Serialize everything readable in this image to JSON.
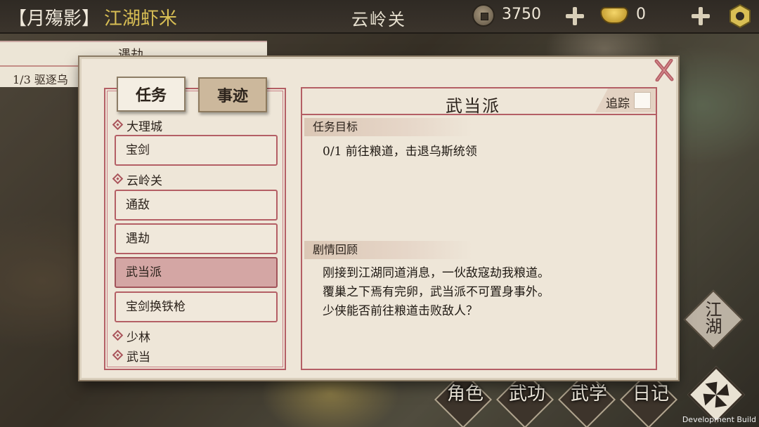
{
  "topbar": {
    "player_name": "【月殤影】",
    "player_title": "江湖虾米",
    "location": "云岭关",
    "coins": "3750",
    "ingots": "0"
  },
  "tracker": {
    "title": "遇劫",
    "text": "1/3  驱逐乌"
  },
  "dialog": {
    "tabs": {
      "tasks": "任务",
      "deeds": "事迹"
    },
    "groups": [
      {
        "name": "大理城",
        "items": [
          "宝剑"
        ]
      },
      {
        "name": "云岭关",
        "items": [
          "通敌",
          "遇劫",
          "武当派",
          "宝剑换铁枪"
        ]
      },
      {
        "name": "少林",
        "items": []
      },
      {
        "name": "武当",
        "items": []
      }
    ],
    "selected_quest": "武当派",
    "detail": {
      "title": "武当派",
      "track_label": "追踪",
      "objective_header": "任务目标",
      "objective": "0/1  前往粮道，击退乌斯统领",
      "story_header": "剧情回顾",
      "story_lines": [
        "刚接到江湖同道消息，一伙敌寇劫我粮道。",
        "覆巢之下焉有完卵，武当派不可置身事外。",
        "少侠能否前往粮道击败敌人？"
      ]
    }
  },
  "menu": {
    "jianghu": "江湖",
    "items": [
      "角色",
      "武功",
      "武学",
      "日记"
    ]
  },
  "dev_build": "Development Build",
  "colors": {
    "accent_red": "#b45f65",
    "paper": "#eee6d8",
    "selected_row": "#d4a6a4",
    "gold_title": "#d8be54"
  }
}
